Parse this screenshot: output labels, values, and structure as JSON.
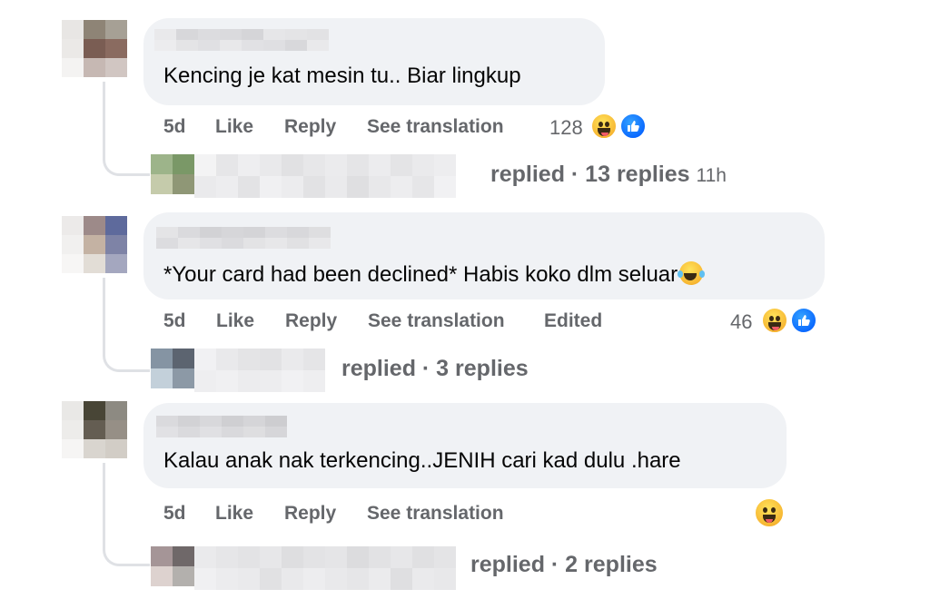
{
  "comments": [
    {
      "text": "Kencing je kat mesin tu.. Biar lingkup",
      "time": "5d",
      "like_label": "Like",
      "reply_label": "Reply",
      "see_translation_label": "See translation",
      "reaction_count": "128",
      "replies_summary": "replied · 13 replies",
      "replies_time": "11h"
    },
    {
      "text": "*Your card had been declined* Habis koko dlm seluar",
      "time": "5d",
      "like_label": "Like",
      "reply_label": "Reply",
      "see_translation_label": "See translation",
      "edited_label": "Edited",
      "reaction_count": "46",
      "replies_summary": "replied · 3 replies"
    },
    {
      "text": "Kalau anak nak terkencing..JENIH cari kad dulu .hare",
      "time": "5d",
      "like_label": "Like",
      "reply_label": "Reply",
      "see_translation_label": "See translation",
      "replies_summary": "replied · 2 replies"
    }
  ],
  "colors": {
    "bubble_bg": "#f0f2f5",
    "meta_text": "#65676b",
    "like_blue": "#0866ff",
    "haha_yellow": "#f7b733"
  },
  "icons": [
    "haha-reaction-icon",
    "like-reaction-icon",
    "laughing-tears-emoji"
  ]
}
